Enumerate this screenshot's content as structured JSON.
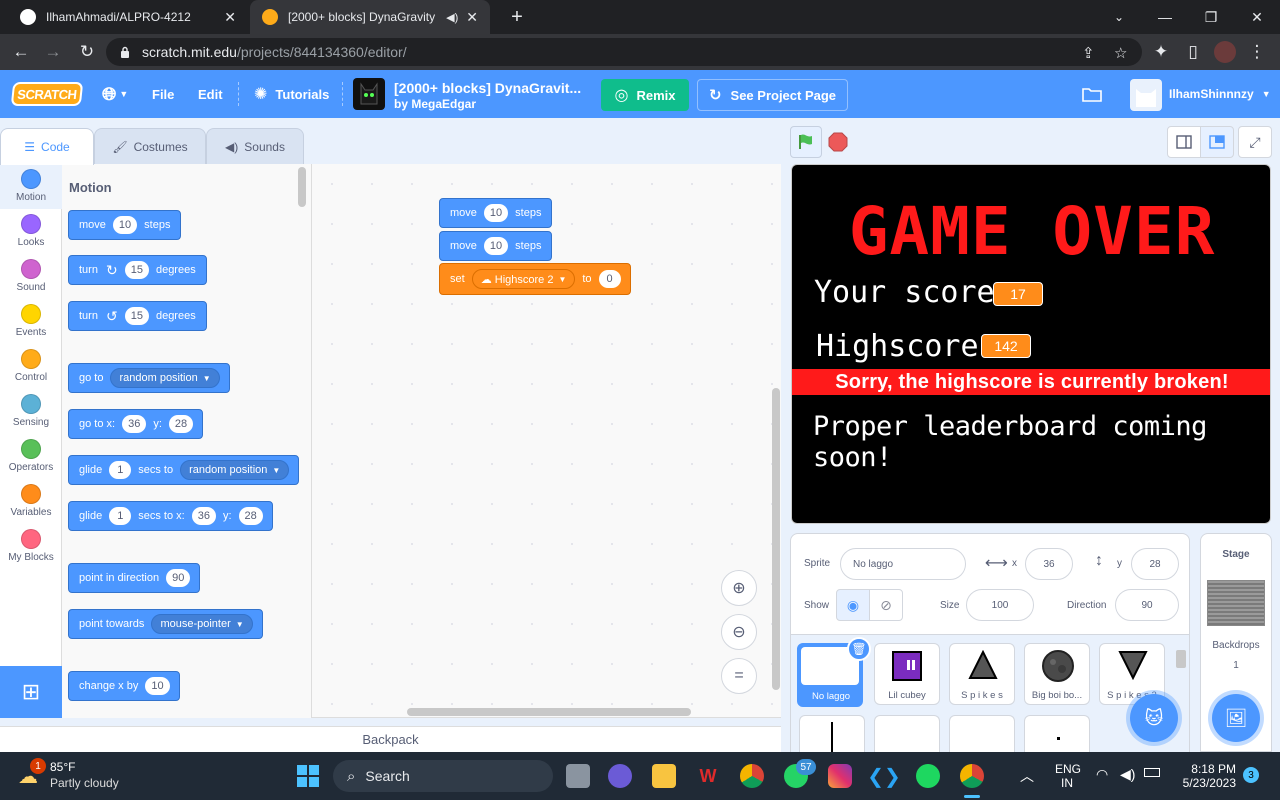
{
  "browser": {
    "tabs": [
      {
        "title": "IlhamAhmadi/ALPRO-4212",
        "active": false
      },
      {
        "title": "[2000+ blocks] DynaGravity",
        "active": true
      }
    ],
    "url_domain": "scratch.mit.edu",
    "url_path": "/projects/844134360/editor/"
  },
  "menubar": {
    "logo": "SCRATCH",
    "file": "File",
    "edit": "Edit",
    "tutorials": "Tutorials",
    "project_title": "[2000+ blocks] DynaGravit...",
    "project_author": "by MegaEdgar",
    "remix": "Remix",
    "see_project_page": "See Project Page",
    "username": "IlhamShinnnzy",
    "accent": "#4c97ff"
  },
  "editor_tabs": [
    {
      "label": "Code",
      "active": true
    },
    {
      "label": "Costumes",
      "active": false
    },
    {
      "label": "Sounds",
      "active": false
    }
  ],
  "categories": [
    {
      "label": "Motion",
      "color": "#4c97ff"
    },
    {
      "label": "Looks",
      "color": "#9966ff"
    },
    {
      "label": "Sound",
      "color": "#cf63cf"
    },
    {
      "label": "Events",
      "color": "#ffd500"
    },
    {
      "label": "Control",
      "color": "#ffab19"
    },
    {
      "label": "Sensing",
      "color": "#5cb1d6"
    },
    {
      "label": "Operators",
      "color": "#59c059"
    },
    {
      "label": "Variables",
      "color": "#ff8c1a"
    },
    {
      "label": "My Blocks",
      "color": "#ff6680"
    }
  ],
  "palette": {
    "heading": "Motion",
    "move": {
      "pre": "move",
      "value": "10",
      "post": "steps"
    },
    "turn_right": {
      "pre": "turn",
      "value": "15",
      "post": "degrees"
    },
    "turn_left": {
      "pre": "turn",
      "value": "15",
      "post": "degrees"
    },
    "goto": {
      "pre": "go to",
      "option": "random position"
    },
    "goto_xy": {
      "pre": "go to x:",
      "x": "36",
      "ylabel": "y:",
      "y": "28"
    },
    "glide": {
      "pre": "glide",
      "secs": "1",
      "mid": "secs to",
      "option": "random position"
    },
    "glide_xy": {
      "pre": "glide",
      "secs": "1",
      "mid": "secs to x:",
      "x": "36",
      "ylabel": "y:",
      "y": "28"
    },
    "point_dir": {
      "pre": "point in direction",
      "value": "90"
    },
    "point_towards": {
      "pre": "point towards",
      "option": "mouse-pointer"
    },
    "change_x": {
      "pre": "change x by",
      "value": "10"
    }
  },
  "script": {
    "move1": {
      "pre": "move",
      "value": "10",
      "post": "steps"
    },
    "move2": {
      "pre": "move",
      "value": "10",
      "post": "steps"
    },
    "set": {
      "pre": "set",
      "variable": "☁ Highscore 2",
      "mid": "to",
      "value": "0"
    }
  },
  "backpack": "Backpack",
  "stage": {
    "title": "GAME OVER",
    "score_label": "Your score:",
    "score": "17",
    "highscore_label": "Highscore:",
    "highscore": "142",
    "broken_msg": "Sorry, the highscore is currently broken!",
    "coming_msg": "Proper leaderboard coming soon!"
  },
  "sprite_info": {
    "sprite_label": "Sprite",
    "sprite_name": "No laggo",
    "x_label": "x",
    "x": "36",
    "y_label": "y",
    "y": "28",
    "show_label": "Show",
    "size_label": "Size",
    "size": "100",
    "direction_label": "Direction",
    "direction": "90"
  },
  "sprites": [
    {
      "name": "No laggo",
      "selected": true
    },
    {
      "name": "Lil cubey"
    },
    {
      "name": "S p i k e s"
    },
    {
      "name": "Big boi bo..."
    },
    {
      "name": "S p i k e s 2"
    }
  ],
  "stage_pane": {
    "title": "Stage",
    "backdrops_label": "Backdrops",
    "backdrops": "1"
  },
  "taskbar": {
    "temp": "85°F",
    "weather": "Partly cloudy",
    "weather_badge": "1",
    "search": "Search",
    "whatsapp_badge": "57",
    "lang": "ENG",
    "lang2": "IN",
    "time": "8:18 PM",
    "date": "5/23/2023",
    "notif": "3"
  }
}
